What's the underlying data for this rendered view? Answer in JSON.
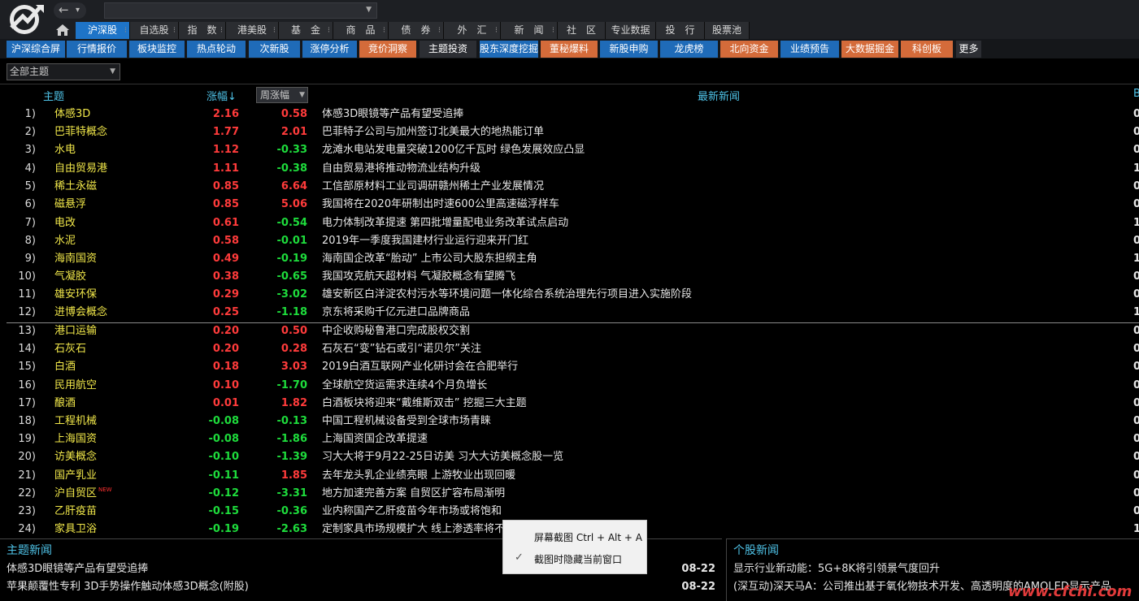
{
  "top_nav": {
    "tabs": [
      {
        "label": "沪深股",
        "active": true
      },
      {
        "label": "自选股"
      },
      {
        "label": "指　数"
      },
      {
        "label": "港美股"
      },
      {
        "label": "基　金"
      },
      {
        "label": "商　品"
      },
      {
        "label": "债　券"
      },
      {
        "label": "外　汇"
      },
      {
        "label": "新　闻"
      },
      {
        "label": "社　区"
      },
      {
        "label": "专业数据"
      },
      {
        "label": "投　行"
      },
      {
        "label": "股票池"
      }
    ],
    "tab_marker": "⁝"
  },
  "sub_nav": {
    "tabs": [
      {
        "label": "沪深综合屏",
        "style": "blue"
      },
      {
        "label": "行情报价",
        "style": "blue"
      },
      {
        "label": "板块监控",
        "style": "blue"
      },
      {
        "label": "热点轮动",
        "style": "blue"
      },
      {
        "label": "次新股",
        "style": "blue"
      },
      {
        "label": "涨停分析",
        "style": "blue"
      },
      {
        "label": "竞价洞察",
        "style": "orange"
      },
      {
        "label": "主题投资",
        "style": "dark"
      },
      {
        "label": "股东深度挖掘",
        "style": "blue"
      },
      {
        "label": "董秘爆料",
        "style": "orange"
      },
      {
        "label": "新股申购",
        "style": "blue"
      },
      {
        "label": "龙虎榜",
        "style": "blue"
      },
      {
        "label": "北向资金",
        "style": "orange"
      },
      {
        "label": "业绩预告",
        "style": "blue"
      },
      {
        "label": "大数据掘金",
        "style": "orange"
      },
      {
        "label": "科创板",
        "style": "orange"
      },
      {
        "label": "更多",
        "style": "dark"
      }
    ]
  },
  "filter": {
    "value": "全部主题"
  },
  "table": {
    "headers": {
      "topic": "主题",
      "change": "涨幅↓",
      "week": "周涨幅",
      "news": "最新新闻",
      "tail": "B"
    },
    "rows": [
      {
        "idx": "1)",
        "name": "体感3D",
        "pct": "2.16",
        "week": "0.58",
        "news": "体感3D眼镜等产品有望受追捧",
        "tail": "0"
      },
      {
        "idx": "2)",
        "name": "巴菲特概念",
        "pct": "1.77",
        "week": "2.01",
        "news": "巴菲特子公司与加州签订北美最大的地热能订单",
        "tail": "0"
      },
      {
        "idx": "3)",
        "name": "水电",
        "pct": "1.12",
        "week": "-0.33",
        "news": "龙滩水电站发电量突破1200亿千瓦时 绿色发展效应凸显",
        "tail": "0"
      },
      {
        "idx": "4)",
        "name": "自由贸易港",
        "pct": "1.11",
        "week": "-0.38",
        "news": "自由贸易港将推动物流业结构升级",
        "tail": "1"
      },
      {
        "idx": "5)",
        "name": "稀土永磁",
        "pct": "0.85",
        "week": "6.64",
        "news": "工信部原材料工业司调研赣州稀土产业发展情况",
        "tail": "0"
      },
      {
        "idx": "6)",
        "name": "磁悬浮",
        "pct": "0.85",
        "week": "5.06",
        "news": "我国将在2020年研制出时速600公里高速磁浮样车",
        "tail": "0"
      },
      {
        "idx": "7)",
        "name": "电改",
        "pct": "0.61",
        "week": "-0.54",
        "news": "电力体制改革提速 第四批增量配电业务改革试点启动",
        "tail": "1"
      },
      {
        "idx": "8)",
        "name": "水泥",
        "pct": "0.58",
        "week": "-0.01",
        "news": "2019年一季度我国建材行业运行迎来开门红",
        "tail": "0"
      },
      {
        "idx": "9)",
        "name": "海南国资",
        "pct": "0.49",
        "week": "-0.19",
        "news": "海南国企改革“胎动” 上市公司大股东担纲主角",
        "tail": "1"
      },
      {
        "idx": "10)",
        "name": "气凝胶",
        "pct": "0.38",
        "week": "-0.65",
        "news": "我国攻克航天超材料 气凝胶概念有望腾飞",
        "tail": "0"
      },
      {
        "idx": "11)",
        "name": "雄安环保",
        "pct": "0.29",
        "week": "-3.02",
        "news": "雄安新区白洋淀农村污水等环境问题一体化综合系统治理先行项目进入实施阶段",
        "tail": "0"
      },
      {
        "idx": "12)",
        "name": "进博会概念",
        "pct": "0.25",
        "week": "-1.18",
        "news": "京东将采购千亿元进口品牌商品",
        "tail": "1"
      },
      {
        "idx": "13)",
        "name": "港口运输",
        "pct": "0.20",
        "week": "0.50",
        "news": "中企收购秘鲁港口完成股权交割",
        "tail": "0"
      },
      {
        "idx": "14)",
        "name": "石灰石",
        "pct": "0.20",
        "week": "0.28",
        "news": "石灰石“变”钻石或引“诺贝尔”关注",
        "tail": "0"
      },
      {
        "idx": "15)",
        "name": "白酒",
        "pct": "0.18",
        "week": "3.03",
        "news": "2019白酒互联网产业化研讨会在合肥举行",
        "tail": "0"
      },
      {
        "idx": "16)",
        "name": "民用航空",
        "pct": "0.10",
        "week": "-1.70",
        "news": "全球航空货运需求连续4个月负增长",
        "tail": "0"
      },
      {
        "idx": "17)",
        "name": "酿酒",
        "pct": "0.01",
        "week": "1.82",
        "news": "白酒板块将迎来“戴维斯双击” 挖掘三大主题",
        "tail": "0"
      },
      {
        "idx": "18)",
        "name": "工程机械",
        "pct": "-0.08",
        "week": "-0.13",
        "news": "中国工程机械设备受到全球市场青睐",
        "tail": "0"
      },
      {
        "idx": "19)",
        "name": "上海国资",
        "pct": "-0.08",
        "week": "-1.86",
        "news": "上海国资国企改革提速",
        "tail": "0"
      },
      {
        "idx": "20)",
        "name": "访美概念",
        "pct": "-0.10",
        "week": "-1.39",
        "news": "习大大将于9月22-25日访美 习大大访美概念股一览",
        "tail": "0"
      },
      {
        "idx": "21)",
        "name": "国产乳业",
        "pct": "-0.11",
        "week": "1.85",
        "news": "去年龙头乳企业绩亮眼 上游牧业出现回暖",
        "tail": "0"
      },
      {
        "idx": "22)",
        "name": "沪自贸区",
        "pct": "-0.12",
        "week": "-3.31",
        "news": "地方加速完善方案 自贸区扩容布局渐明",
        "tail": "0",
        "badge": "NEW"
      },
      {
        "idx": "23)",
        "name": "乙肝疫苗",
        "pct": "-0.15",
        "week": "-0.36",
        "news": "业内称国产乙肝疫苗今年市场或将饱和",
        "tail": "0"
      },
      {
        "idx": "24)",
        "name": "家具卫浴",
        "pct": "-0.19",
        "week": "-2.63",
        "news": "定制家具市场规模扩大 线上渗透率将不断提升",
        "tail": "1"
      }
    ]
  },
  "bottom_left": {
    "title": "主题新闻",
    "items": [
      {
        "text": "体感3D眼镜等产品有望受追捧",
        "date": "08-22"
      },
      {
        "text": "苹果颠覆性专利 3D手势操作触动体感3D概念(附股)",
        "date": "08-22"
      }
    ]
  },
  "bottom_right": {
    "title": "个股新闻",
    "items": [
      {
        "text": "显示行业新动能：5G+8K将引领景气度回升"
      },
      {
        "text": "(深互动)深天马A：公司推出基于氧化物技术开发、高透明度的AMOLED显示产品"
      }
    ]
  },
  "context_menu": {
    "items": [
      {
        "label": "屏幕截图 Ctrl + Alt + A"
      },
      {
        "label": "截图时隐藏当前窗口",
        "checked": true
      }
    ]
  },
  "watermark": "www.cfchi.com",
  "colors": {
    "up": "#ff3b3b",
    "down": "#1edc3c",
    "topic": "#f2e84a",
    "header": "#4fc3e8",
    "active_tab": "#1e74c8",
    "orange_tab": "#d46b3a"
  }
}
